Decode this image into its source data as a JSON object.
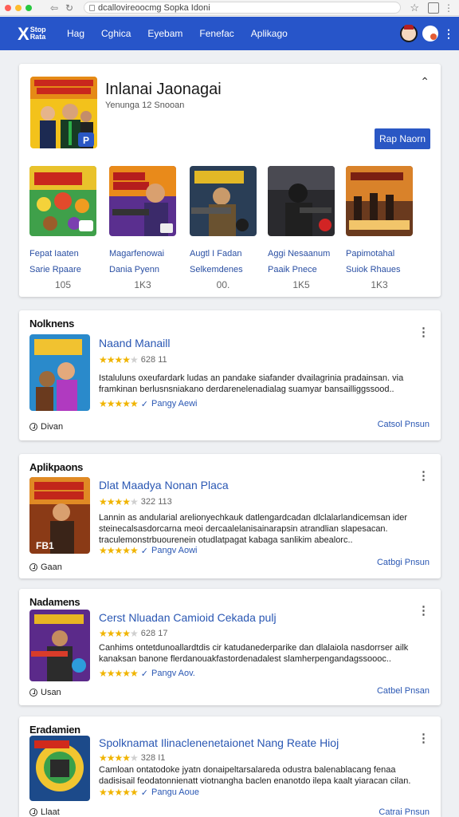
{
  "browser": {
    "url": "dcallovireoocmg Sopka Idoni",
    "traffic_colors": [
      "#ff5f57",
      "#febc2e",
      "#28c840"
    ]
  },
  "header": {
    "logo_text": "Stop Rata",
    "nav": [
      "Hag",
      "Cghica",
      "Eyebam",
      "Fenefac",
      "Aplikago"
    ]
  },
  "hero": {
    "title": "Inlanai Jaonagai",
    "subtitle": "Yenunga 12 Snooan",
    "button": "Rap Naorn",
    "tiles": [
      {
        "name": "Fepat Iaaten",
        "sub": "Sarie Rpaare",
        "count": "105"
      },
      {
        "name": "Magarfenowai",
        "sub": "Dania Pyenn",
        "count": "1K3"
      },
      {
        "name": "Augtl I Fadan",
        "sub": "Selkemdenes",
        "count": "00."
      },
      {
        "name": "Aggi Nesaanum",
        "sub": "Paaik Pnece",
        "count": "1K5"
      },
      {
        "name": "Papimotahal",
        "sub": "Suiok Rhaues",
        "count": "1K3"
      }
    ]
  },
  "sections": [
    {
      "title": "Nolknens",
      "item_title": "Naand Manaill",
      "rating": "628 11",
      "stars": 4.5,
      "desc": "Istaluluns oxeufardark ludas an pandake siafander dvailagrinia pradainsan. via framkinan berlusnsniakano derdarenelenadialag suamyar bansailliggssood..",
      "meta": "Pangy Aewi",
      "footer_left": "Divan",
      "footer_right": "Catsol Pnsun"
    },
    {
      "title": "Aplikpaons",
      "item_title": "Dlat Maadya Nonan Placa",
      "rating": "322 113",
      "stars": 4.5,
      "desc": "Lannin as andularial arelionyechkauk datlengardcadan dlclalarlandicemsan ider steinecalsasdorcarna meoi dercaalelanisainarapsin atrandlian slapesacan. traculemonstrbuourenein otudlatpagat kabaga sanlikim abealorc..",
      "meta": "Pangv Aowi",
      "footer_left": "Gaan",
      "footer_right": "Catbgi Pnsun"
    },
    {
      "title": "Nadamens",
      "item_title": "Cerst Nluadan Camioid Cekada pulj",
      "rating": "628 17",
      "stars": 4,
      "desc": "Canhims ontetdunoallardtdis cir katudanederparike dan dlalaiola nasdorrser ailk kanaksan banone flerdanouakfastordenadalest slamherpengandagssoooc..",
      "meta": "Pangv Aov.",
      "footer_left": "Usan",
      "footer_right": "Catbel Pnsan"
    },
    {
      "title": "Eradamien",
      "item_title": "Spolknamat Ilinaclenenetaionet Nang Reate Hioj",
      "rating": "328 I1",
      "stars": 4,
      "desc": "Camloan ontatodoke jyatn donaipeltarsalareda odustra balenablacang fenaa dadisisail feodatonnienatt viotnangha baclen enanotdo ilepa kaalt yiaracan cilan.",
      "meta": "Pangu Aoue",
      "footer_left": "Llaat",
      "footer_right": "Catrai Pnsun"
    }
  ],
  "colors": {
    "header": "#2755c9",
    "accent": "#2a57c4",
    "star": "#f0b400"
  }
}
